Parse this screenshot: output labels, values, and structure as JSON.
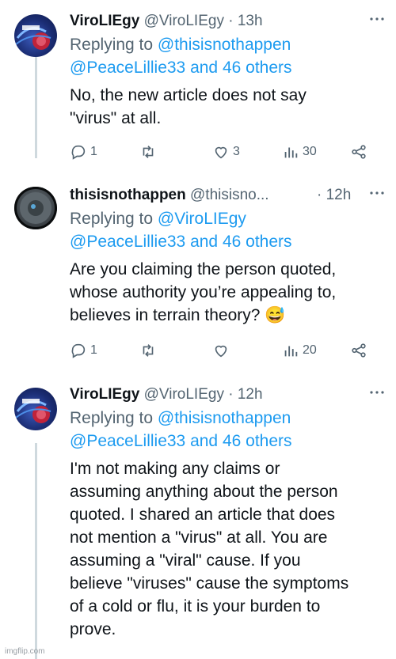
{
  "tweets": [
    {
      "name": "ViroLIEgy",
      "handle": "@ViroLIEgy",
      "time": "· 13h",
      "replying_prefix": "Replying to ",
      "replying_line1": "@thisisnothappen",
      "replying_line2": "@PeaceLillie33 and 46 others",
      "body_lines": [
        "No, the new article does not say",
        "\"virus\" at all."
      ],
      "replies": "1",
      "retweets": "",
      "likes": "3",
      "views": "30"
    },
    {
      "name": "thisisnothappen",
      "handle": "@thisisno...",
      "time": "· 12h",
      "replying_prefix": "Replying to ",
      "replying_line1": "@ViroLIEgy",
      "replying_line2": "@PeaceLillie33 and 46 others",
      "body_lines": [
        "Are you claiming the person quoted,",
        "whose authority you’re appealing to,",
        "believes in terrain theory? 😅"
      ],
      "replies": "1",
      "retweets": "",
      "likes": "",
      "views": "20"
    },
    {
      "name": "ViroLIEgy",
      "handle": "@ViroLIEgy",
      "time": "· 12h",
      "replying_prefix": "Replying to ",
      "replying_line1": "@thisisnothappen",
      "replying_line2": "@PeaceLillie33 and 46 others",
      "body_lines": [
        "I'm not making any claims or",
        "assuming anything about the person",
        "quoted. I shared an article that does",
        "not mention a \"virus\" at all. You are",
        "assuming a \"viral\" cause. If you",
        "believe \"viruses\" cause the symptoms",
        "of a cold or flu, it is your burden to",
        "prove."
      ]
    }
  ],
  "icons": [
    "reply-icon",
    "retweet-icon",
    "like-icon",
    "views-icon",
    "share-icon",
    "more-icon"
  ],
  "colors": {
    "link": "#1d9bf0",
    "secondary": "#536471",
    "primary": "#0f1419",
    "thread_line": "#cfd9de"
  },
  "watermark": "imgflip.com"
}
